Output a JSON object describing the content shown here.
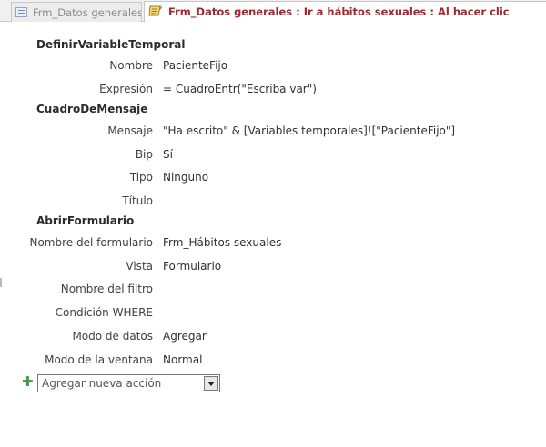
{
  "tabs": [
    {
      "label": "Frm_Datos generales",
      "icon": "form-icon",
      "active": false
    },
    {
      "label": "Frm_Datos generales : Ir a hábitos sexuales : Al hacer clic",
      "icon": "macro-icon",
      "active": true
    }
  ],
  "actions": [
    {
      "name": "DefinirVariableTemporal",
      "args": [
        {
          "label": "Nombre",
          "value": "PacienteFijo"
        },
        {
          "label": "Expresión",
          "value": "= CuadroEntr(\"Escriba var\")"
        }
      ]
    },
    {
      "name": "CuadroDeMensaje",
      "args": [
        {
          "label": "Mensaje",
          "value": "\"Ha escrito\" & [Variables temporales]![\"PacienteFijo\"]"
        },
        {
          "label": "Bip",
          "value": "Sí"
        },
        {
          "label": "Tipo",
          "value": "Ninguno"
        },
        {
          "label": "Título",
          "value": ""
        }
      ]
    },
    {
      "name": "AbrirFormulario",
      "args": [
        {
          "label": "Nombre del formulario",
          "value": "Frm_Hábitos sexuales"
        },
        {
          "label": "Vista",
          "value": "Formulario"
        },
        {
          "label": "Nombre del filtro",
          "value": ""
        },
        {
          "label": "Condición WHERE",
          "value": ""
        },
        {
          "label": "Modo de datos",
          "value": "Agregar"
        },
        {
          "label": "Modo de la ventana",
          "value": "Normal"
        }
      ]
    }
  ],
  "add_action": {
    "placeholder": "Agregar nueva acción",
    "icon": "plus-icon"
  },
  "colors": {
    "active_tab_text": "#a3282d",
    "add_icon": "#3d9a3d"
  }
}
